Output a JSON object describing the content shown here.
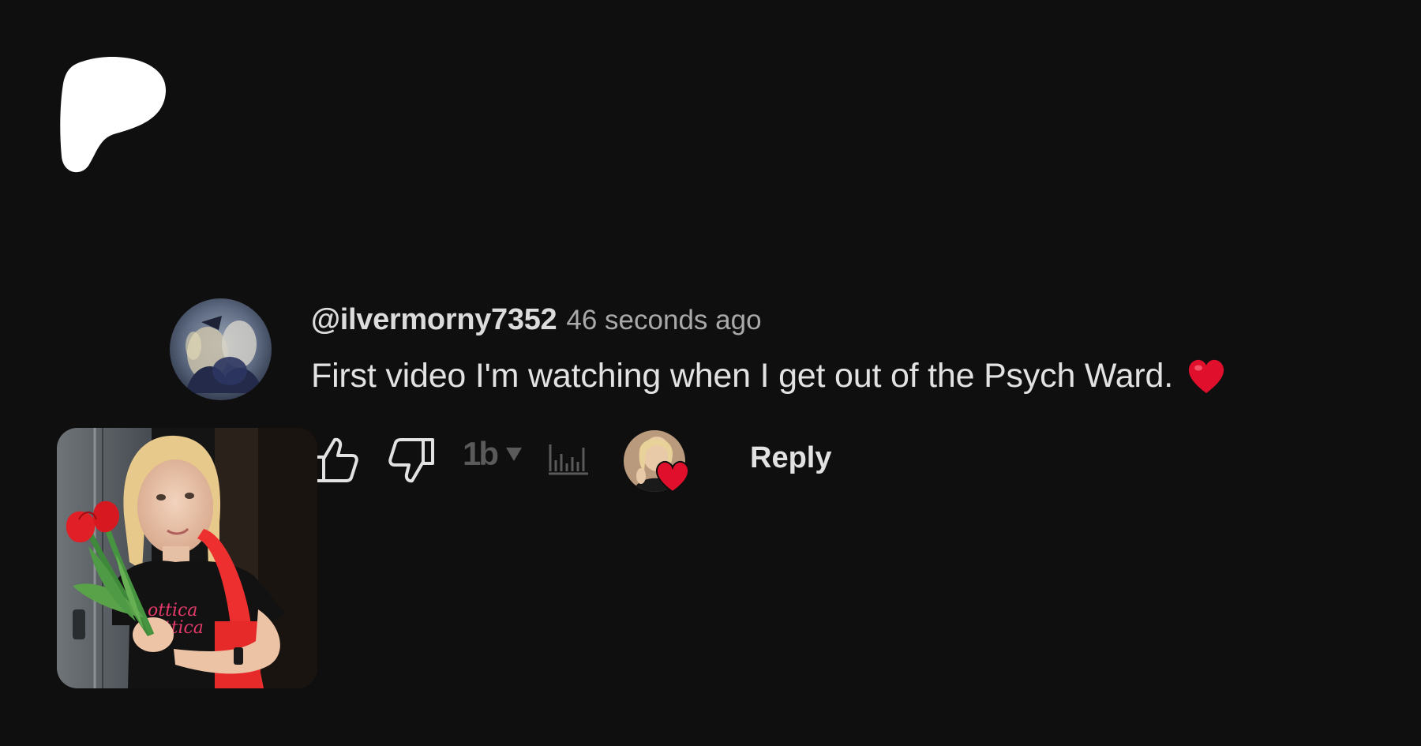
{
  "comment": {
    "username": "@ilvermorny7352",
    "timestamp": "46 seconds ago",
    "text": "First video I'm watching when I get out of the Psych Ward.",
    "like_count": "1b",
    "reply_label": "Reply"
  },
  "icons": {
    "brand_logo": "patreon-logo-icon",
    "like": "thumbs-up-icon",
    "dislike": "thumbs-down-icon",
    "count_dropdown": "caret-down-icon",
    "stats": "bar-chart-icon",
    "comment_emoji": "red-heart-icon",
    "creator_heart": "creator-heart-badge-icon"
  },
  "colors": {
    "background": "#0f0f10",
    "heart": "#e0102c",
    "logo": "#ffffff"
  }
}
